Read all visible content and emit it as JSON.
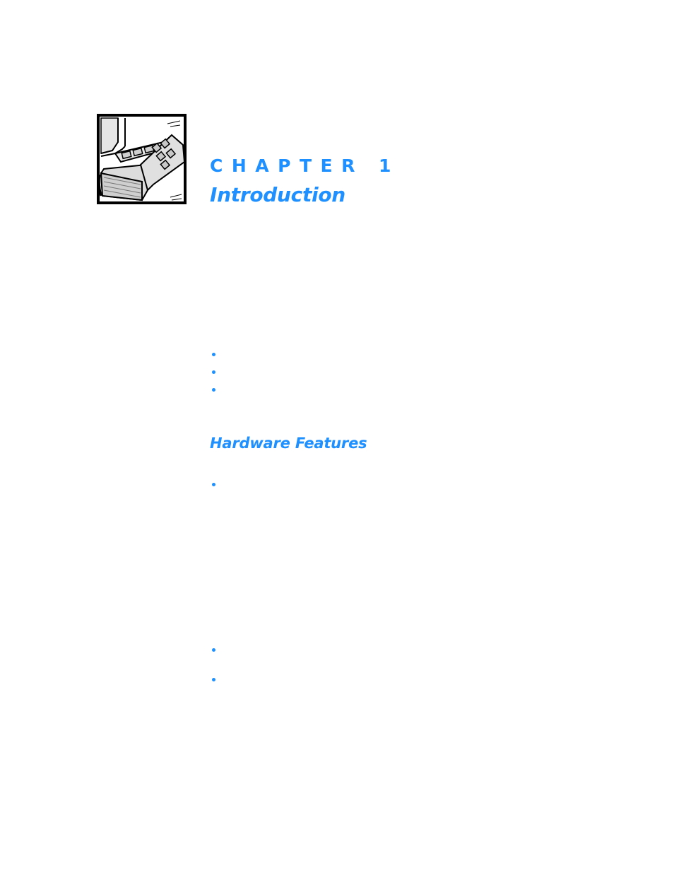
{
  "chapter": {
    "label": "CHAPTER 1",
    "title": "Introduction",
    "icon": "book-and-circuit-board-icon"
  },
  "intro_list": {
    "items": [
      "",
      "",
      ""
    ]
  },
  "section": {
    "heading": "Hardware Features"
  },
  "hardware_list": {
    "items": [
      "",
      "",
      ""
    ]
  },
  "colors": {
    "accent": "#1E90FF",
    "text": "#000000",
    "background": "#FFFFFF"
  }
}
